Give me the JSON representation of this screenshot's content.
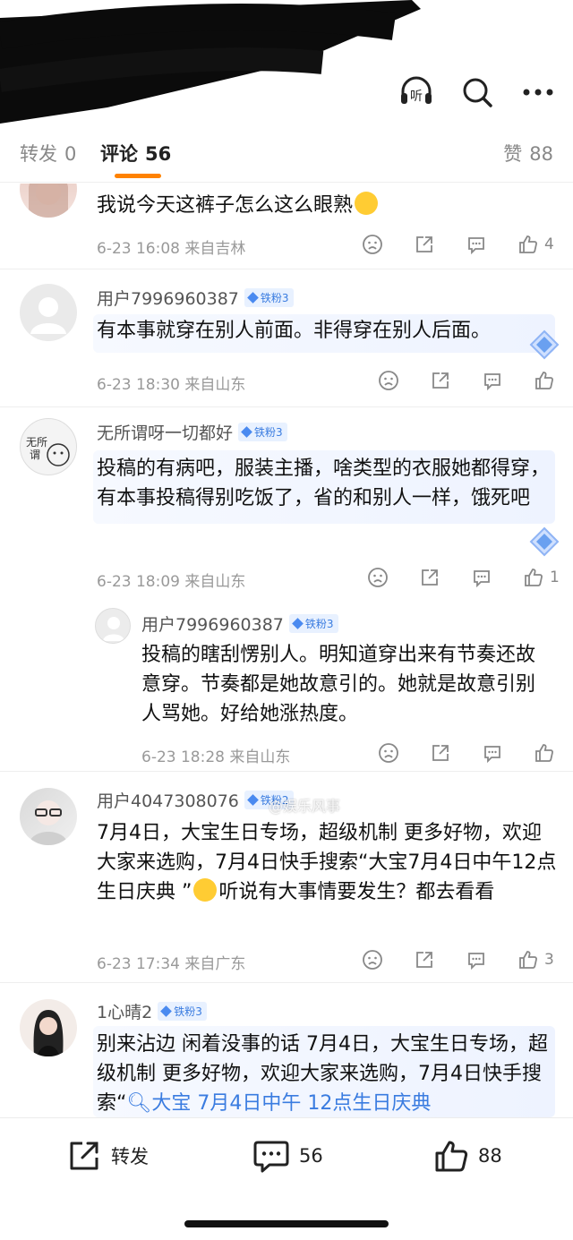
{
  "top_actions": [
    {
      "name": "listen-icon",
      "label": "听"
    },
    {
      "name": "search-icon"
    },
    {
      "name": "more-icon"
    }
  ],
  "tabs": {
    "repost_label": "转发",
    "repost_count": "0",
    "comment_label": "评论",
    "comment_count": "56",
    "like_label": "赞",
    "like_count": "88"
  },
  "comments": [
    {
      "text": "我说今天这裤子怎么这么眼熟",
      "meta": "6-23 16:08  来自吉林",
      "likes": "4"
    },
    {
      "user": "用户7996960387",
      "badge": "铁粉3",
      "text": "有本事就穿在别人前面。非得穿在别人后面。",
      "meta": "6-23 18:30  来自山东",
      "likes": ""
    },
    {
      "user": "无所谓呀一切都好",
      "badge": "铁粉3",
      "text": "投稿的有病吧，服装主播，啥类型的衣服她都得穿，有本事投稿得别吃饭了，省的和别人一样，饿死吧",
      "meta": "6-23 18:09  来自山东",
      "likes": "1"
    },
    {
      "user": "用户7996960387",
      "badge": "铁粉3",
      "text": "投稿的瞎刮愣别人。明知道穿出来有节奏还故意穿。节奏都是她故意引的。她就是故意引别人骂她。好给她涨热度。",
      "meta": "6-23 18:28  来自山东",
      "likes": ""
    },
    {
      "user": "用户4047308076",
      "badge": "铁粉2",
      "text_a": "7月4日，大宝生日专场，超级机制 更多好物，欢迎大家来选购，7月4日快手搜索“大宝7月4日中午12点生日庆典 ”",
      "text_b": "听说有大事情要发生？都去看看",
      "meta": "6-23 17:34  来自广东",
      "likes": "3"
    },
    {
      "user": "1心晴2",
      "badge": "铁粉3",
      "text_a": "别来沾边 闲着没事的话 7月4日，大宝生日专场，超级机制 更多好物，欢迎大家来选购，7月4日快手搜索“",
      "text_link": "大宝 7月4日中午 12点生日庆典"
    }
  ],
  "watermark": "@娱乐风事",
  "bottom": {
    "repost_label": "转发",
    "comment_count": "56",
    "like_count": "88"
  },
  "colors": {
    "accent": "#ff8200",
    "badge_blue": "#3a7ce0",
    "link_blue": "#3a7ce0"
  }
}
